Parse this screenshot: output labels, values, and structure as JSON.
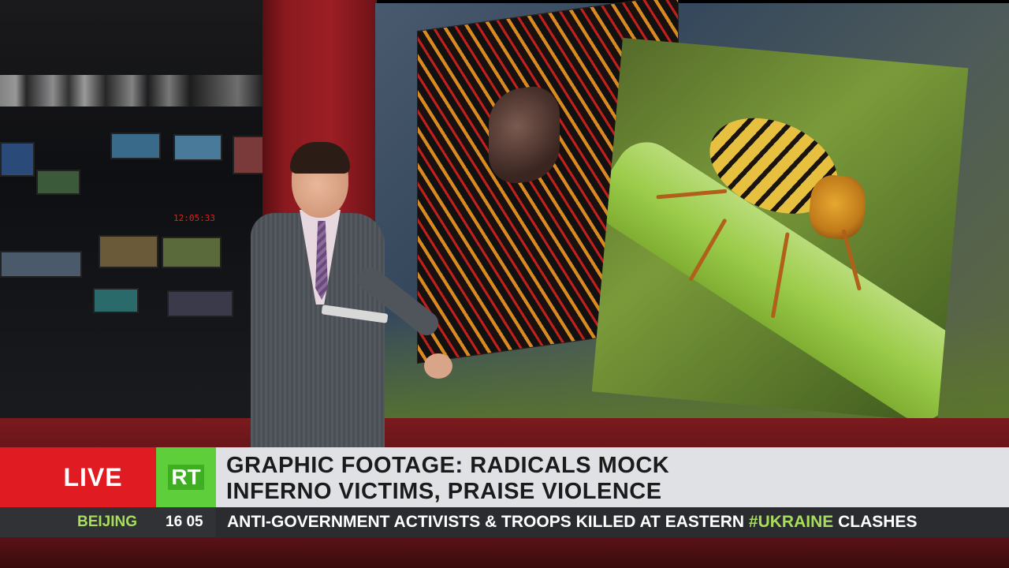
{
  "lower_third": {
    "live_label": "LIVE",
    "logo_text": "RT",
    "headline_line1": "GRAPHIC FOOTAGE: RADICALS MOCK",
    "headline_line2": "INFERNO VICTIMS, PRAISE VIOLENCE",
    "location": "BEIJING",
    "time": "16 05",
    "ticker_before_tag": "ANTI-GOVERNMENT ACTIVISTS & TROOPS KILLED AT EASTERN ",
    "ticker_hashtag": "#UKRAINE",
    "ticker_after_tag": " CLASHES"
  },
  "studio": {
    "clock_readout": "12:05:33"
  },
  "colors": {
    "live_red": "#e01b22",
    "rt_green": "#5fce3b",
    "hashtag_green": "#a7de5a",
    "ticker_bg": "#2a2c30"
  }
}
